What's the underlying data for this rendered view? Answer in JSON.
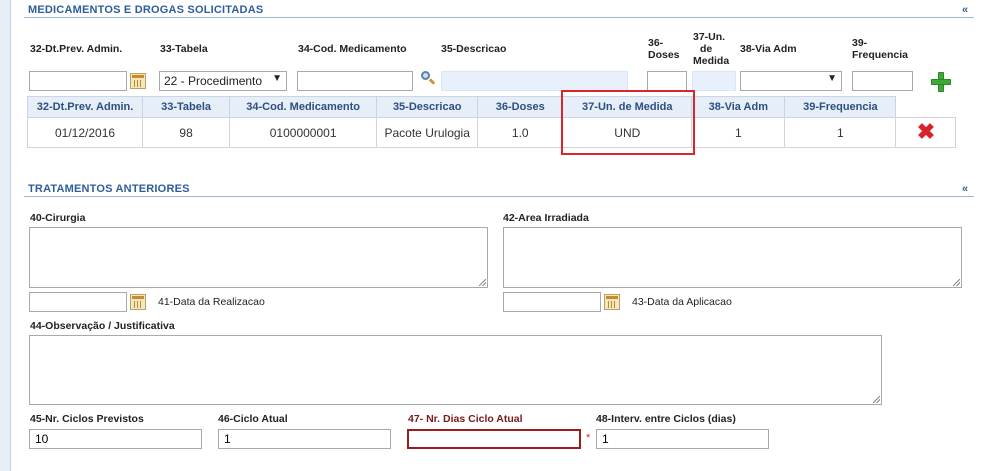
{
  "sections": {
    "medications_title": "MEDICAMENTOS E DROGAS SOLICITADAS",
    "treatments_title": "TRATAMENTOS ANTERIORES",
    "collapse_symbol": "«"
  },
  "med_form": {
    "labels": {
      "dt_prev": "32-Dt.Prev. Admin.",
      "tabela": "33-Tabela",
      "cod": "34-Cod. Medicamento",
      "desc": "35-Descricao",
      "doses_a": "36-",
      "doses_b": "Doses",
      "un_a": "37-Un.",
      "un_b": "de",
      "un_c": "Medida",
      "via": "38-Via Adm",
      "freq_a": "39-",
      "freq_b": "Frequencia"
    },
    "values": {
      "dt_prev": "",
      "tabela": "22 - Procedimento",
      "cod": "",
      "desc": "",
      "doses": "",
      "un": "",
      "via": "",
      "freq": ""
    }
  },
  "med_table": {
    "headers": [
      "32-Dt.Prev. Admin.",
      "33-Tabela",
      "34-Cod. Medicamento",
      "35-Descricao",
      "36-Doses",
      "37-Un. de Medida",
      "38-Via Adm",
      "39-Frequencia"
    ],
    "rows": [
      [
        "01/12/2016",
        "98",
        "0100000001",
        "Pacote Urulogia",
        "1.0",
        "UND",
        "1",
        "1"
      ]
    ]
  },
  "treatments": {
    "labels": {
      "cirurgia": "40-Cirurgia",
      "area": "42-Area Irradiada",
      "data_realizacao": "41-Data da Realizacao",
      "data_aplicacao": "43-Data da Aplicacao",
      "observacao": "44-Observação / Justificativa",
      "ciclos_previstos": "45-Nr. Ciclos Previstos",
      "ciclo_atual": "46-Ciclo Atual",
      "dias_ciclo": "47- Nr. Dias Ciclo Atual",
      "interv": "48-Interv. entre Ciclos (dias)"
    },
    "values": {
      "cirurgia": "",
      "area": "",
      "data_realizacao": "",
      "data_aplicacao": "",
      "observacao": "",
      "ciclos_previstos": "10",
      "ciclo_atual": "1",
      "dias_ciclo": "",
      "interv": "1"
    },
    "required_mark": "*"
  }
}
